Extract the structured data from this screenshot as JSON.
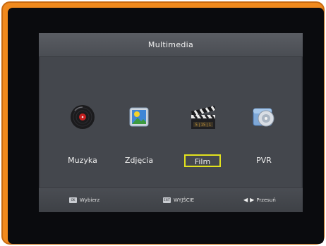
{
  "screen": {
    "title": "Multimedia",
    "items": [
      {
        "label": "Muzyka",
        "icon": "vinyl-record-icon",
        "selected": false
      },
      {
        "label": "Zdjęcia",
        "icon": "photo-icon",
        "selected": false
      },
      {
        "label": "Film",
        "icon": "clapperboard-icon",
        "selected": true
      },
      {
        "label": "PVR",
        "icon": "disc-drive-icon",
        "selected": false
      }
    ],
    "footer": {
      "ok_key": "OK",
      "ok_label": "Wybierz",
      "exit_key": "EXIT",
      "exit_label": "WYJŚCIE",
      "move_label": "Przesuń",
      "clapper_digits": "5 | 15 | 1"
    }
  },
  "colors": {
    "bezel_accent": "#f08a1e",
    "screen_bg": "#44474d",
    "selection_border": "#e2e21e"
  }
}
